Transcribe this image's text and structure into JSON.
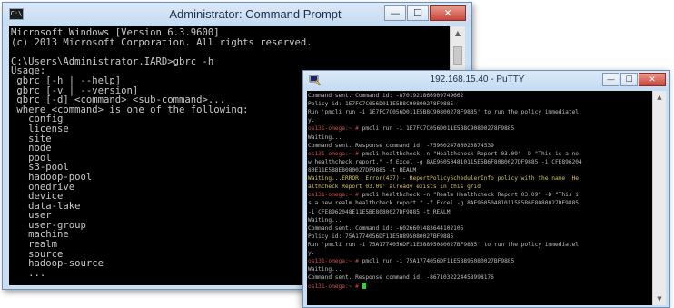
{
  "cmd_window": {
    "title": "Administrator: Command Prompt",
    "icon_label": "C:\\",
    "buttons": {
      "minimize": "—",
      "maximize": "☐",
      "close": "✕"
    },
    "lines": [
      "Microsoft Windows [Version 6.3.9600]",
      "(c) 2013 Microsoft Corporation. All rights reserved.",
      "",
      "C:\\Users\\Administrator.IARD>gbrc -h",
      "Usage:",
      " gbrc [-h | --help]",
      " gbrc [-v | --version]",
      " gbrc [-d] <command> <sub-command>...",
      " where <command> is one of the following:",
      "   config",
      "   license",
      "   site",
      "   node",
      "   pool",
      "   s3-pool",
      "   hadoop-pool",
      "   onedrive",
      "   device",
      "   data-lake",
      "   user",
      "   user-group",
      "   machine",
      "   realm",
      "   source",
      "   hadoop-source",
      "   ..."
    ]
  },
  "putty_window": {
    "title": "192.168.15.40 - PuTTY",
    "buttons": {
      "minimize": "—",
      "maximize": "☐",
      "close": "✕"
    },
    "lines": [
      {
        "kind": "normal",
        "text": "Command sent. Command id: -8701921866909749662"
      },
      {
        "kind": "normal",
        "text": "Policy id: 1E7FC7C056D011E5B8C90800278F9885"
      },
      {
        "kind": "normal",
        "text": "Run 'pmcli run -i 1E7FC7C056D011E5B8C90800278F9885' to run the policy immediatel"
      },
      {
        "kind": "normal",
        "text": "y."
      },
      {
        "kind": "prompt",
        "prompt": "os131-omega:~ # ",
        "text": "pmcli run -i 1E7FC7C056D011E5B8C90800278F9885"
      },
      {
        "kind": "normal",
        "text": "Waiting..."
      },
      {
        "kind": "normal",
        "text": "Command sent. Response command id: -7596024786020874539"
      },
      {
        "kind": "prompt",
        "prompt": "os131-omega:~ # ",
        "text": "pmcli healthcheck -n \"Healthcheck Report 03.09\" -D \"This is a ne"
      },
      {
        "kind": "normal",
        "text": "w healthcheck report.\" -f Excel -g 8AE960504810115E5B6F8080027DF9885 -i CFE896204"
      },
      {
        "kind": "normal",
        "text": "80E11E5B8E8080027DF9885 -t REALM"
      },
      {
        "kind": "error",
        "text": "Waiting...ERROR  Error(437) - ReportPolicySchedulerInfo policy with the name 'He"
      },
      {
        "kind": "error",
        "text": "althcheck Report 03.09' already exists in this grid"
      },
      {
        "kind": "prompt",
        "prompt": "os131-omega:~ # ",
        "text": "pmcli healthcheck -n \"Realm Healthcheck Report 03.09\" -D \"This i"
      },
      {
        "kind": "normal",
        "text": "s a new realm healthcheck report.\" -f Excel -g 8AE960504810115E5B6F8080027DF9885"
      },
      {
        "kind": "normal",
        "text": "-i CFE8962048E11E5BE8080027DF9885 -t REALM"
      },
      {
        "kind": "normal",
        "text": "Waiting..."
      },
      {
        "kind": "normal",
        "text": "Command sent. Command id: -6026601483644102105"
      },
      {
        "kind": "normal",
        "text": "Policy id: 75A1774056DF11E58895080027BF9885"
      },
      {
        "kind": "normal",
        "text": "Run 'pmcli run -i 75A1774056DF11E58895080027BF9885' to run the policy immediatel"
      },
      {
        "kind": "normal",
        "text": "y."
      },
      {
        "kind": "prompt",
        "prompt": "os131-omega:~ # ",
        "text": "pmcli run -i 75A1774056DF11E58895080027BF9885"
      },
      {
        "kind": "normal",
        "text": "Waiting..."
      },
      {
        "kind": "normal",
        "text": "Command sent. Response command id: -8671032224458998176"
      },
      {
        "kind": "prompt",
        "prompt": "os131-omega:~ # ",
        "text": ""
      }
    ]
  },
  "icons": {
    "cmd": "command-prompt-icon",
    "putty": "putty-icon"
  }
}
